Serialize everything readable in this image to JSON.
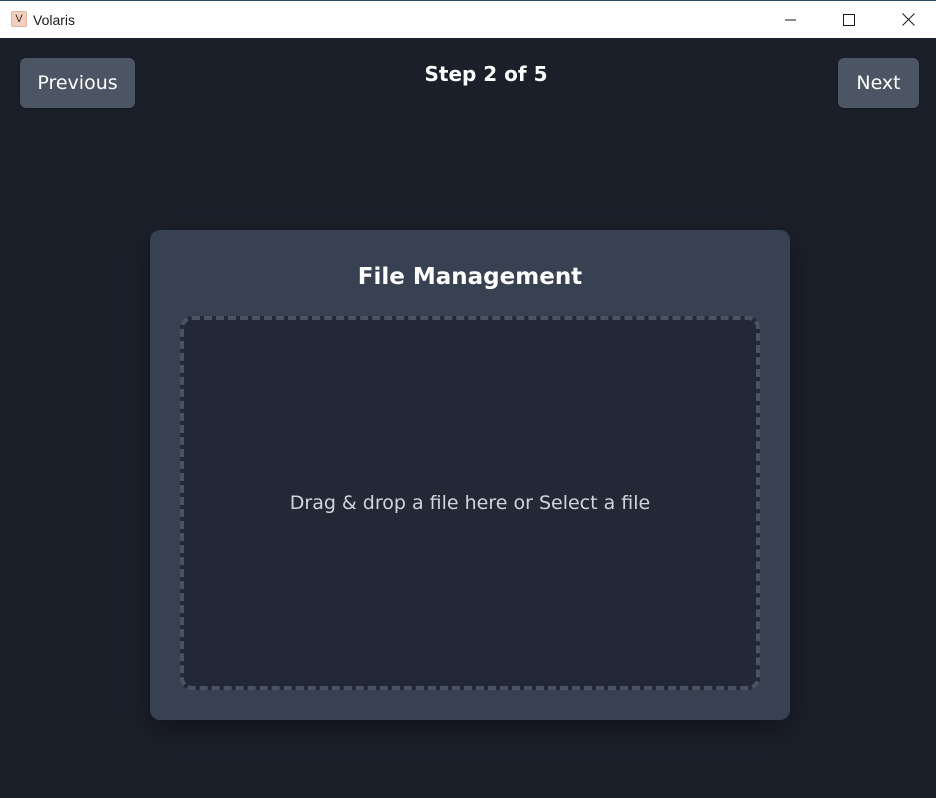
{
  "window": {
    "app_icon_letter": "V",
    "title": "Volaris",
    "controls": {
      "minimize_icon": "minimize-icon",
      "maximize_icon": "maximize-icon",
      "close_icon": "close-icon"
    }
  },
  "header": {
    "previous_label": "Previous",
    "step_text": "Step 2 of 5",
    "next_label": "Next"
  },
  "card": {
    "title": "File Management",
    "dropzone_text": "Drag & drop a file here or Select a file"
  },
  "colors": {
    "background": "#1b1f2a",
    "card": "#374151",
    "dropzone": "#222836",
    "button": "#4b5563",
    "dashed_border": "#4a5362"
  }
}
